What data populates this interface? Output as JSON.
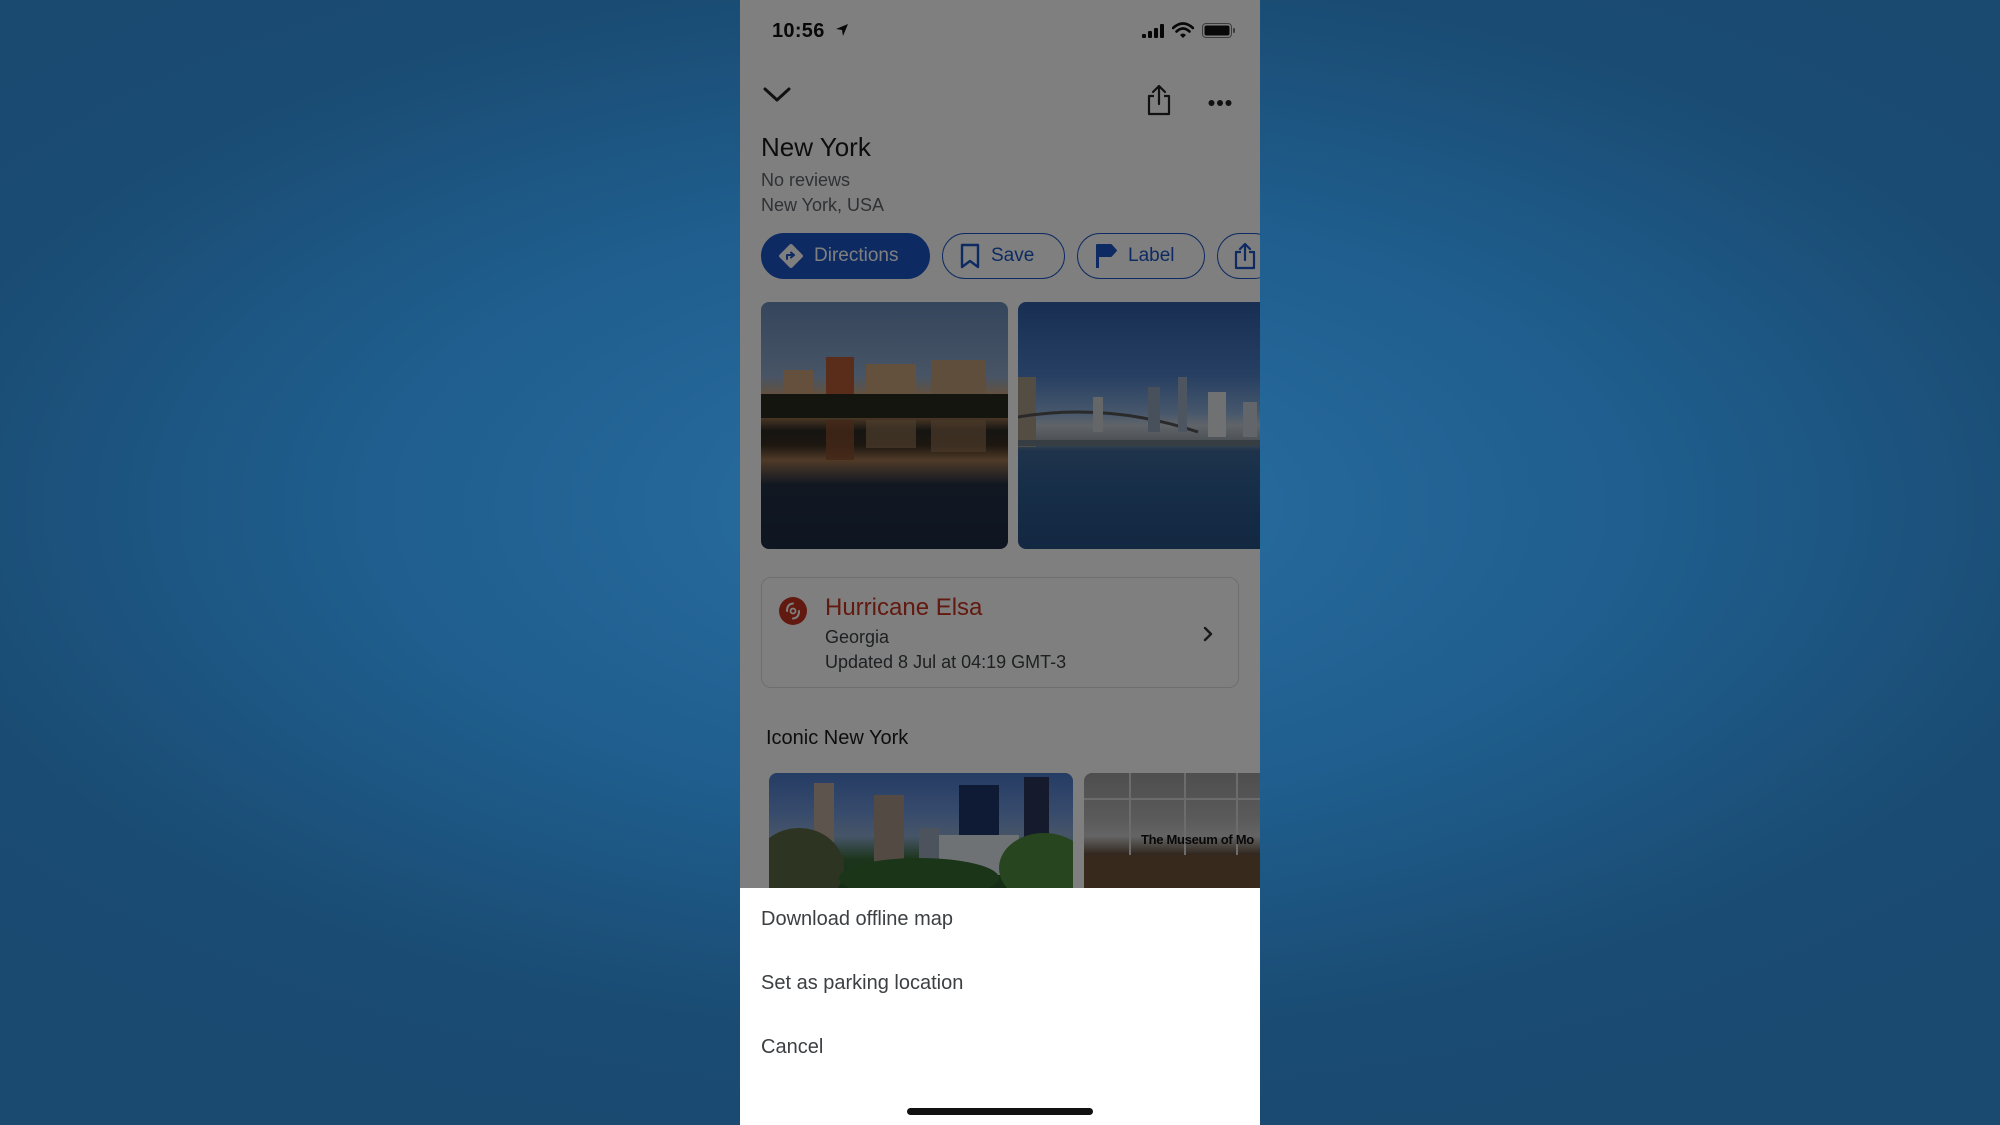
{
  "status_bar": {
    "time": "10:56",
    "icons": [
      "location-arrow-icon",
      "cellular-signal-icon",
      "wifi-icon",
      "battery-icon"
    ]
  },
  "header": {
    "collapse_icon": "chevron-down-icon",
    "share_icon": "share-icon",
    "more_icon": "more-horizontal-icon"
  },
  "place": {
    "title": "New York",
    "reviews": "No reviews",
    "address": "New York, USA"
  },
  "actions": [
    {
      "label": "Directions",
      "icon": "directions-icon",
      "primary": true
    },
    {
      "label": "Save",
      "icon": "bookmark-icon",
      "primary": false
    },
    {
      "label": "Label",
      "icon": "flag-icon",
      "primary": false
    },
    {
      "label": "",
      "icon": "share-icon",
      "primary": false
    }
  ],
  "photos": [
    {
      "description": "Central Park reservoir skyline reflection"
    },
    {
      "description": "Brooklyn Bridge and Lower Manhattan skyline"
    }
  ],
  "alert": {
    "icon": "hurricane-icon",
    "title": "Hurricane Elsa",
    "region": "Georgia",
    "updated": "Updated 8 Jul at 04:19 GMT-3",
    "color": "#c5321e"
  },
  "section": {
    "title": "Iconic New York",
    "cards": [
      {
        "description": "Central Park skyline"
      },
      {
        "description": "Museum of Modern Art entrance",
        "sign_text": "The Museum of Mo"
      }
    ]
  },
  "action_sheet": {
    "items": [
      "Download offline map",
      "Set as parking location",
      "Cancel"
    ]
  },
  "colors": {
    "accent": "#1a56c4",
    "alert": "#c5321e",
    "background": "#1f5e8e"
  }
}
